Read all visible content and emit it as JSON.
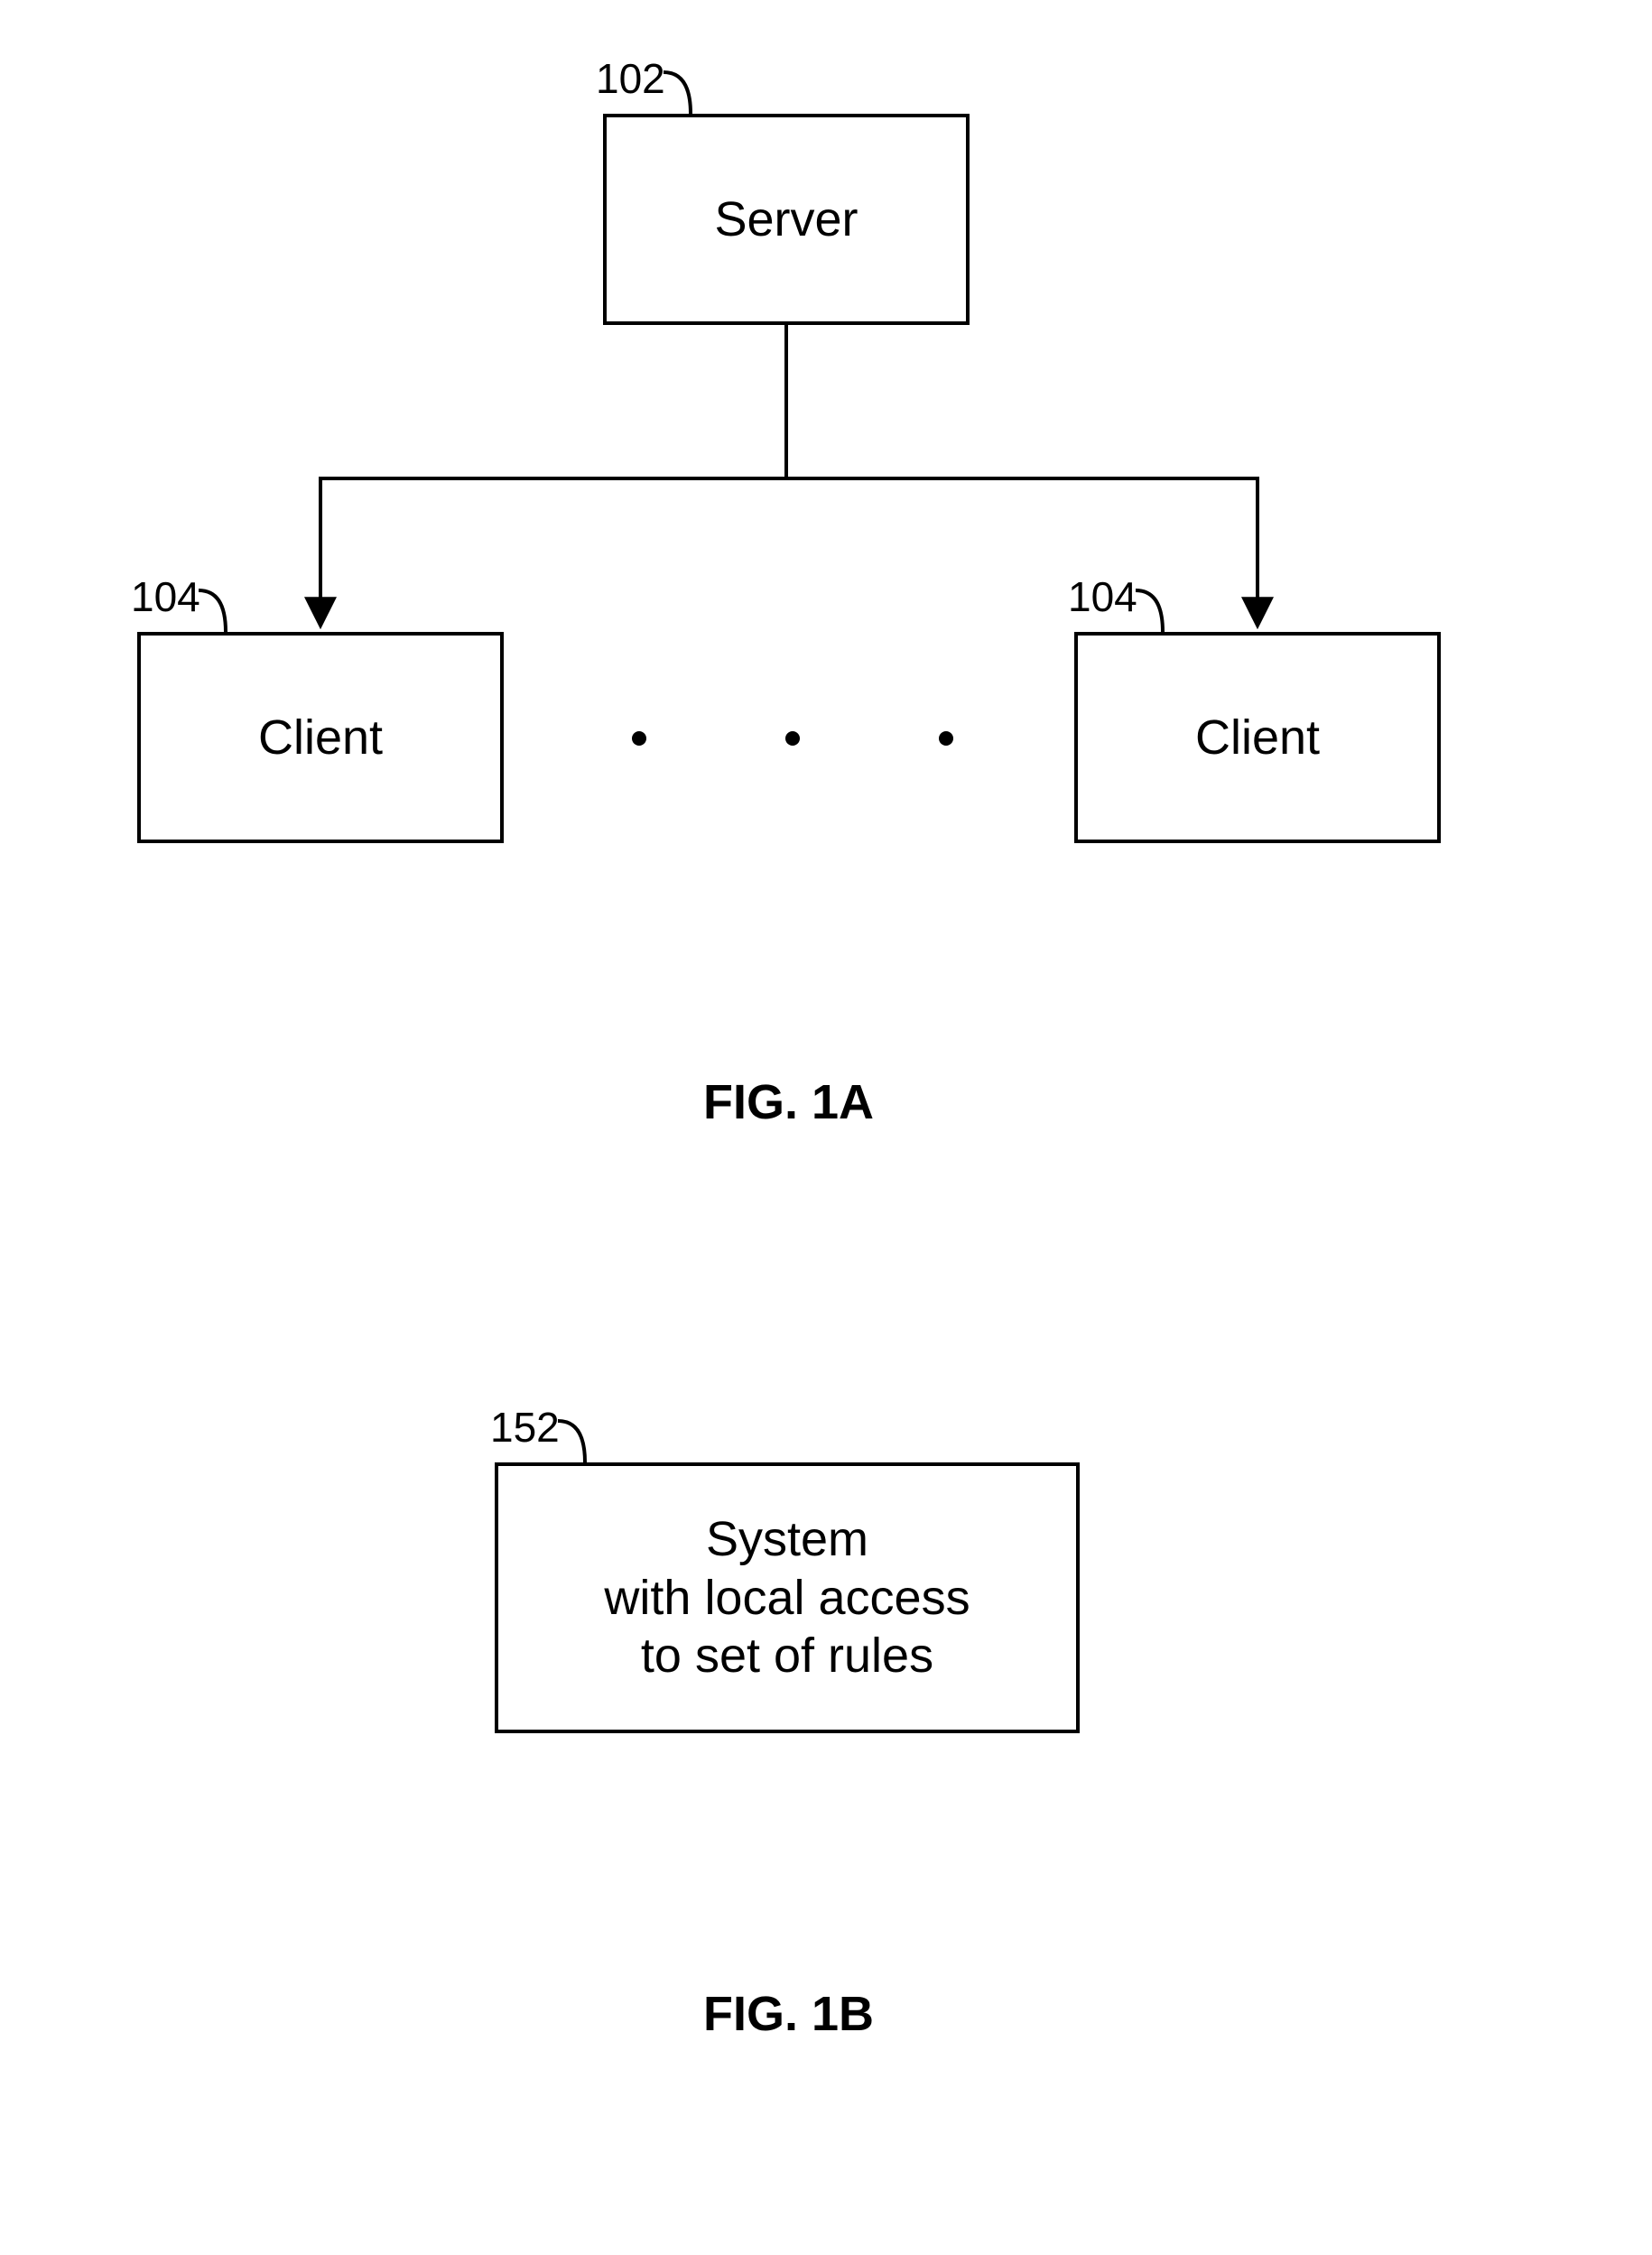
{
  "fig1a": {
    "server": {
      "ref": "102",
      "label": "Server"
    },
    "client_left": {
      "ref": "104",
      "label": "Client"
    },
    "client_right": {
      "ref": "104",
      "label": "Client"
    },
    "caption": "FIG. 1A"
  },
  "fig1b": {
    "system": {
      "ref": "152",
      "label": "System\nwith local access\nto set of rules"
    },
    "caption": "FIG. 1B"
  }
}
